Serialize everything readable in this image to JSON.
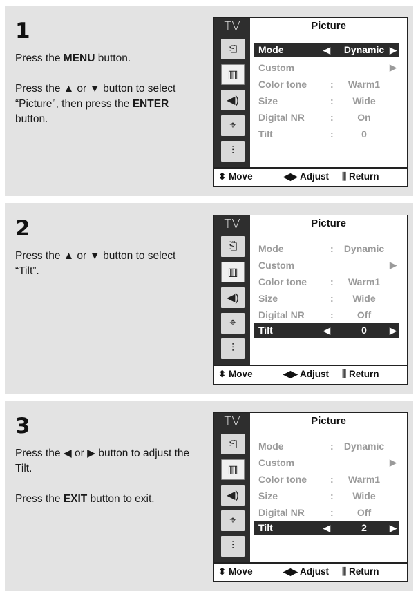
{
  "steps": [
    {
      "number": "1",
      "paragraphs": [
        [
          "Press the ",
          {
            "b": "MENU"
          },
          " button."
        ],
        [
          "Press the ▲ or ▼ button to select “Picture”, then press the ",
          {
            "b": "ENTER"
          },
          " button."
        ]
      ],
      "menu": {
        "tv_label": "TV",
        "title": "Picture",
        "rows": [
          {
            "label": "Mode",
            "value": "Dynamic",
            "style": "hl-arrows"
          },
          {
            "label": "Custom",
            "value": "",
            "style": "submenu"
          },
          {
            "label": "Color tone",
            "value": "Warm1",
            "style": "colon"
          },
          {
            "label": "Size",
            "value": "Wide",
            "style": "colon"
          },
          {
            "label": "Digital NR",
            "value": "On",
            "style": "colon"
          },
          {
            "label": "Tilt",
            "value": "0",
            "style": "colon"
          }
        ],
        "footer": {
          "move": "Move",
          "adjust": "Adjust",
          "return": "Return"
        }
      }
    },
    {
      "number": "2",
      "paragraphs": [
        [
          "Press the ▲ or ▼ button to select “Tilt”."
        ]
      ],
      "menu": {
        "tv_label": "TV",
        "title": "Picture",
        "rows": [
          {
            "label": "Mode",
            "value": "Dynamic",
            "style": "colon"
          },
          {
            "label": "Custom",
            "value": "",
            "style": "submenu"
          },
          {
            "label": "Color tone",
            "value": "Warm1",
            "style": "colon"
          },
          {
            "label": "Size",
            "value": "Wide",
            "style": "colon"
          },
          {
            "label": "Digital NR",
            "value": "Off",
            "style": "colon"
          },
          {
            "label": "Tilt",
            "value": "0",
            "style": "hl-arrows"
          }
        ],
        "footer": {
          "move": "Move",
          "adjust": "Adjust",
          "return": "Return"
        }
      }
    },
    {
      "number": "3",
      "paragraphs": [
        [
          "Press the ◀ or ▶ button to adjust the Tilt."
        ],
        [
          "Press the ",
          {
            "b": "EXIT"
          },
          " button to exit."
        ]
      ],
      "menu": {
        "tv_label": "TV",
        "title": "Picture",
        "rows": [
          {
            "label": "Mode",
            "value": "Dynamic",
            "style": "colon"
          },
          {
            "label": "Custom",
            "value": "",
            "style": "submenu"
          },
          {
            "label": "Color tone",
            "value": "Warm1",
            "style": "colon"
          },
          {
            "label": "Size",
            "value": "Wide",
            "style": "colon"
          },
          {
            "label": "Digital NR",
            "value": "Off",
            "style": "colon"
          },
          {
            "label": "Tilt",
            "value": "2",
            "style": "hl-arrows"
          }
        ],
        "footer": {
          "move": "Move",
          "adjust": "Adjust",
          "return": "Return"
        }
      }
    }
  ],
  "side_icons": [
    "input-icon",
    "picture-icon",
    "sound-icon",
    "channel-icon",
    "setup-icon"
  ]
}
